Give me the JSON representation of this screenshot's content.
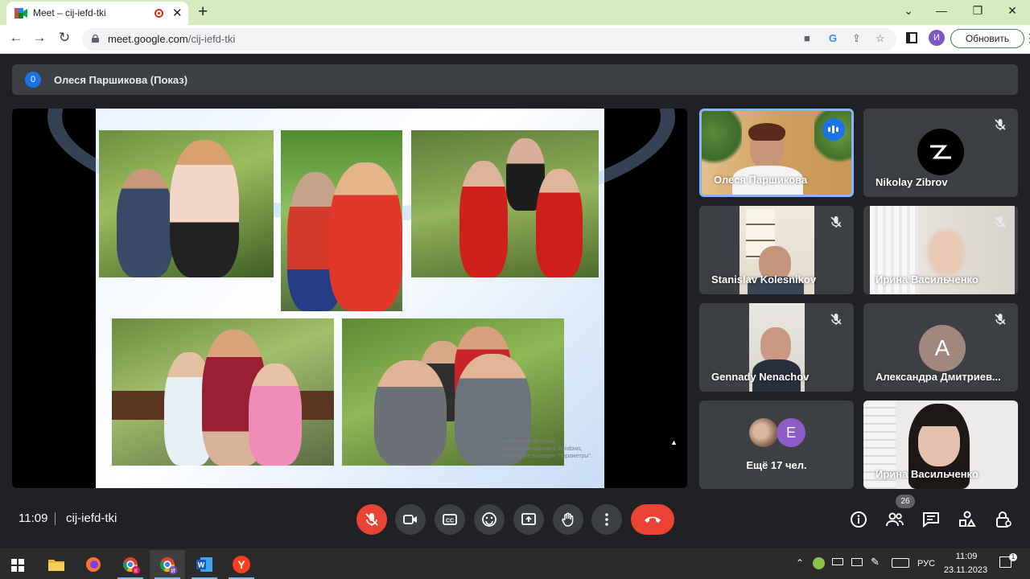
{
  "browser": {
    "tab_title": "Meet – cij-iefd-tki",
    "url_host": "meet.google.com",
    "url_path": "/cij-iefd-tki",
    "profile_letter": "И",
    "update_label": "Обновить"
  },
  "presenter": {
    "badge": "0",
    "label": "Олеся Паршикова (Показ)"
  },
  "slide": {
    "watermark_line1": "Активация Windows",
    "watermark_line2": "Чтобы активировать Windows, перейдите в раздел \"Параметры\"."
  },
  "participants": [
    {
      "name": "Олеся Паршикова",
      "speaking": true
    },
    {
      "name": "Nikolay Zibrov",
      "muted": true
    },
    {
      "name": "Stanislav Kolesnikov",
      "muted": true
    },
    {
      "name": "Ирина Васильченко",
      "muted": true
    },
    {
      "name": "Gennady Nenachov",
      "muted": true
    },
    {
      "name": "Александра Дмитриев...",
      "muted": true,
      "avatar_letter": "А"
    },
    {
      "more_label": "Ещё 17 чел.",
      "avatar_letter": "Е"
    },
    {
      "name": "Ирина Васильченко",
      "muted": true
    }
  ],
  "bottom_bar": {
    "time": "11:09",
    "meeting_code": "cij-iefd-tki",
    "participant_count": "26"
  },
  "taskbar": {
    "language": "РУС",
    "time": "11:09",
    "date": "23.11.2023"
  },
  "colors": {
    "leave_red": "#ea4335",
    "accent_blue": "#1a73e8",
    "tab_strip_green": "#d7ebc1"
  }
}
